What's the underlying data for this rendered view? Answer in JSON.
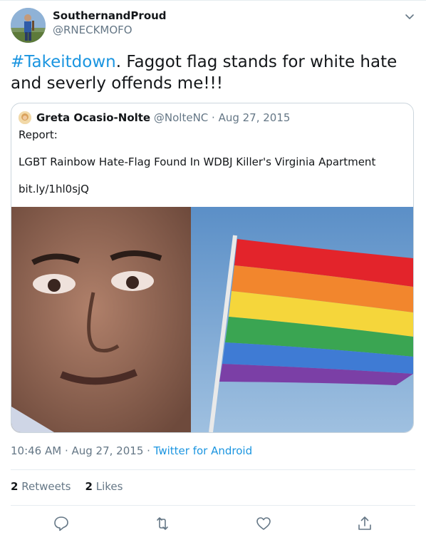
{
  "author": {
    "name": "SouthernandProud",
    "handle": "@RNECKMOFO"
  },
  "tweet": {
    "hashtag": "#Takeitdown",
    "text": ". Faggot flag stands for white hate and severly offends me!!!"
  },
  "quoted_tweet": {
    "name": "Greta Ocasio-Nolte",
    "handle": "@NolteNC",
    "separator": " · ",
    "date": "Aug 27, 2015",
    "line1": "Report:",
    "line2": "LGBT Rainbow Hate-Flag Found In WDBJ Killer's Virginia Apartment",
    "line3": "bit.ly/1hl0sjQ"
  },
  "meta": {
    "time": "10:46 AM · Aug 27, 2015",
    "separator": " · ",
    "source": "Twitter for Android"
  },
  "stats": {
    "retweets_count": "2",
    "retweets_label": "Retweets",
    "likes_count": "2",
    "likes_label": "Likes"
  },
  "icons": {
    "more": "chevron-down-icon",
    "reply": "reply-icon",
    "retweet": "retweet-icon",
    "like": "heart-icon",
    "share": "share-icon"
  },
  "colors": {
    "link": "#1b95e0",
    "secondary_text": "#657786",
    "border": "#ccd6dd"
  }
}
